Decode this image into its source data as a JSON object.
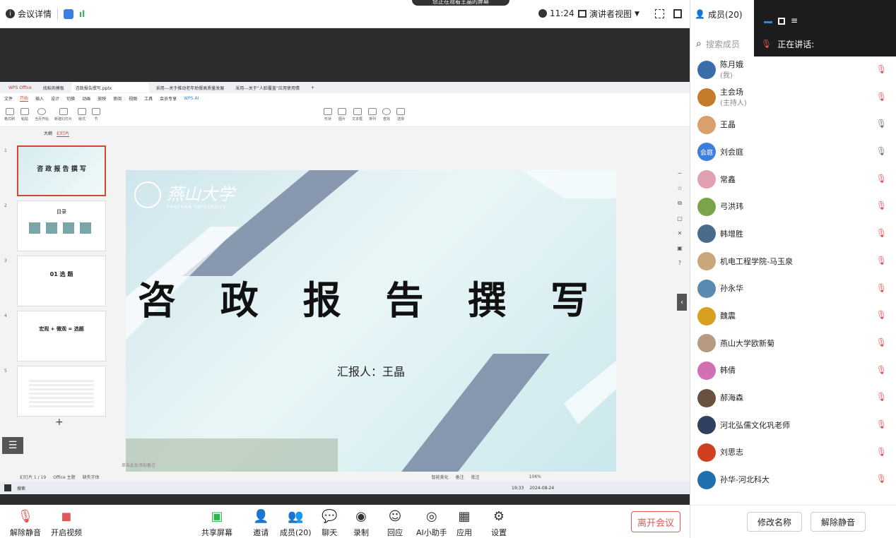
{
  "meeting_topbar": {
    "details_label": "会议详情",
    "sharing_banner": "您正在观看王晶的屏幕",
    "time": "11:24",
    "view_label": "演讲者视图"
  },
  "wps": {
    "tabs": [
      "WPS Office",
      "找稻壳模板",
      "咨政报告撰写.pptx",
      "采用---关于推动老年助餐高质量发展",
      "采用---关于“人脸覆盖”应用使用情",
      "+"
    ],
    "menu": [
      "文件",
      "开始",
      "插入",
      "设计",
      "切换",
      "动画",
      "放映",
      "审阅",
      "视图",
      "工具",
      "会员专享",
      "WPS AI"
    ],
    "ribbon": [
      "格式刷",
      "粘贴",
      "当页开始",
      "新建幻灯片",
      "版式",
      "节",
      "形状",
      "图片",
      "文本框",
      "排列",
      "查找",
      "选择"
    ],
    "panel_tabs": [
      "大纲",
      "幻灯片"
    ],
    "thumbs": [
      {
        "num": "1",
        "text": "咨 政 报 告 撰 写"
      },
      {
        "num": "2",
        "text": "目录"
      },
      {
        "num": "3",
        "text": "01 选 题"
      },
      {
        "num": "4",
        "text": "宏观 + 微观 = 选题"
      },
      {
        "num": "5",
        "text": ""
      }
    ],
    "slide": {
      "logo_cn": "燕山大学",
      "logo_en": "YANSHAN UNIVERSITY",
      "title": "咨 政 报 告 撰 写",
      "subtitle": "汇报人：王晶"
    },
    "notes_placeholder": "单击此处添加备注",
    "status": [
      "幻灯片 1 / 19",
      "Office 主题",
      "缺失字体",
      "智能美化",
      "备注",
      "批注",
      "106%"
    ],
    "taskbar": {
      "search": "搜索",
      "clock": "19:33",
      "date": "2024-08-24"
    }
  },
  "bottombar": {
    "unmute": "解除静音",
    "video": "开启视频",
    "share": "共享屏幕",
    "invite": "邀请",
    "members": "成员(20)",
    "chat": "聊天",
    "record": "录制",
    "react": "回应",
    "ai": "AI小助手",
    "apps": "应用",
    "settings": "设置",
    "leave": "离开会议"
  },
  "panel": {
    "title": "成员(20)",
    "search_placeholder": "搜索成员",
    "speaking_label": "正在讲话:",
    "members": [
      {
        "name": "陈月娥",
        "sub": "(我)",
        "color": "#3b6ea8",
        "mic": "muted"
      },
      {
        "name": "主会场",
        "sub": "(主持人)",
        "color": "#c47b2a",
        "mic": "muted"
      },
      {
        "name": "王晶",
        "sub": "",
        "color": "#d9a06b",
        "mic": "on"
      },
      {
        "name": "刘会庭",
        "sub": "",
        "color": "#3d7fe0",
        "mic": "on",
        "initials": "会庭"
      },
      {
        "name": "常鑫",
        "sub": "",
        "color": "#e0a0b0",
        "mic": "muted"
      },
      {
        "name": "弓洪玮",
        "sub": "",
        "color": "#7aa34a",
        "mic": "muted"
      },
      {
        "name": "韩增胜",
        "sub": "",
        "color": "#4a6b8a",
        "mic": "muted"
      },
      {
        "name": "机电工程学院-马玉泉",
        "sub": "",
        "color": "#c8a878",
        "mic": "muted"
      },
      {
        "name": "孙永华",
        "sub": "",
        "color": "#5a8ab0",
        "mic": "muted"
      },
      {
        "name": "魏震",
        "sub": "",
        "color": "#d8a020",
        "mic": "muted"
      },
      {
        "name": "燕山大学欧新菊",
        "sub": "",
        "color": "#b89a80",
        "mic": "muted"
      },
      {
        "name": "韩倩",
        "sub": "",
        "color": "#d070b0",
        "mic": "muted"
      },
      {
        "name": "郝海森",
        "sub": "",
        "color": "#6a5040",
        "mic": "muted"
      },
      {
        "name": "河北弘儒文化巩老师",
        "sub": "",
        "color": "#304060",
        "mic": "muted"
      },
      {
        "name": "刘思志",
        "sub": "",
        "color": "#d04020",
        "mic": "muted"
      },
      {
        "name": "孙华-河北科大",
        "sub": "",
        "color": "#2070b0",
        "mic": "muted"
      }
    ],
    "rename_button": "修改名称",
    "unmute_button": "解除静音"
  }
}
